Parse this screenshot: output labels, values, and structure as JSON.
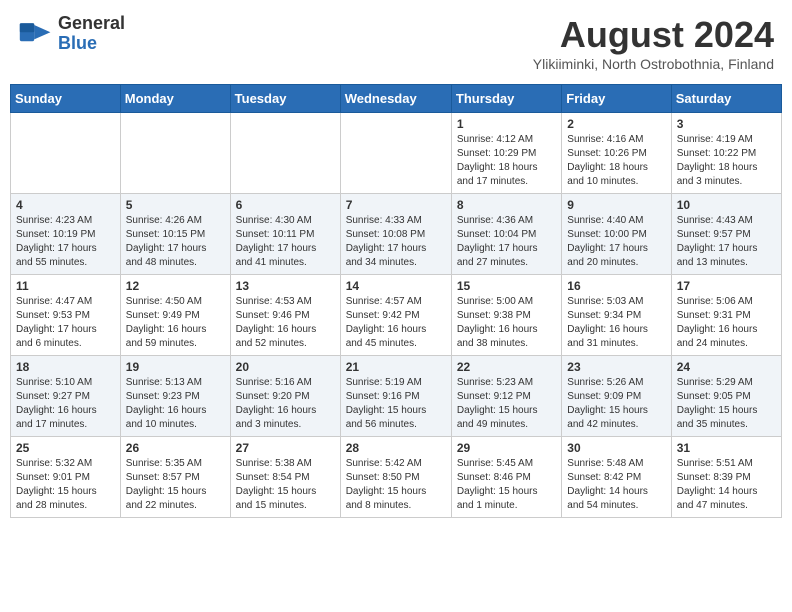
{
  "header": {
    "logo_general": "General",
    "logo_blue": "Blue",
    "month_title": "August 2024",
    "location": "Ylikiiminki, North Ostrobothnia, Finland"
  },
  "days_of_week": [
    "Sunday",
    "Monday",
    "Tuesday",
    "Wednesday",
    "Thursday",
    "Friday",
    "Saturday"
  ],
  "weeks": [
    [
      {
        "day": "",
        "info": ""
      },
      {
        "day": "",
        "info": ""
      },
      {
        "day": "",
        "info": ""
      },
      {
        "day": "",
        "info": ""
      },
      {
        "day": "1",
        "info": "Sunrise: 4:12 AM\nSunset: 10:29 PM\nDaylight: 18 hours\nand 17 minutes."
      },
      {
        "day": "2",
        "info": "Sunrise: 4:16 AM\nSunset: 10:26 PM\nDaylight: 18 hours\nand 10 minutes."
      },
      {
        "day": "3",
        "info": "Sunrise: 4:19 AM\nSunset: 10:22 PM\nDaylight: 18 hours\nand 3 minutes."
      }
    ],
    [
      {
        "day": "4",
        "info": "Sunrise: 4:23 AM\nSunset: 10:19 PM\nDaylight: 17 hours\nand 55 minutes."
      },
      {
        "day": "5",
        "info": "Sunrise: 4:26 AM\nSunset: 10:15 PM\nDaylight: 17 hours\nand 48 minutes."
      },
      {
        "day": "6",
        "info": "Sunrise: 4:30 AM\nSunset: 10:11 PM\nDaylight: 17 hours\nand 41 minutes."
      },
      {
        "day": "7",
        "info": "Sunrise: 4:33 AM\nSunset: 10:08 PM\nDaylight: 17 hours\nand 34 minutes."
      },
      {
        "day": "8",
        "info": "Sunrise: 4:36 AM\nSunset: 10:04 PM\nDaylight: 17 hours\nand 27 minutes."
      },
      {
        "day": "9",
        "info": "Sunrise: 4:40 AM\nSunset: 10:00 PM\nDaylight: 17 hours\nand 20 minutes."
      },
      {
        "day": "10",
        "info": "Sunrise: 4:43 AM\nSunset: 9:57 PM\nDaylight: 17 hours\nand 13 minutes."
      }
    ],
    [
      {
        "day": "11",
        "info": "Sunrise: 4:47 AM\nSunset: 9:53 PM\nDaylight: 17 hours\nand 6 minutes."
      },
      {
        "day": "12",
        "info": "Sunrise: 4:50 AM\nSunset: 9:49 PM\nDaylight: 16 hours\nand 59 minutes."
      },
      {
        "day": "13",
        "info": "Sunrise: 4:53 AM\nSunset: 9:46 PM\nDaylight: 16 hours\nand 52 minutes."
      },
      {
        "day": "14",
        "info": "Sunrise: 4:57 AM\nSunset: 9:42 PM\nDaylight: 16 hours\nand 45 minutes."
      },
      {
        "day": "15",
        "info": "Sunrise: 5:00 AM\nSunset: 9:38 PM\nDaylight: 16 hours\nand 38 minutes."
      },
      {
        "day": "16",
        "info": "Sunrise: 5:03 AM\nSunset: 9:34 PM\nDaylight: 16 hours\nand 31 minutes."
      },
      {
        "day": "17",
        "info": "Sunrise: 5:06 AM\nSunset: 9:31 PM\nDaylight: 16 hours\nand 24 minutes."
      }
    ],
    [
      {
        "day": "18",
        "info": "Sunrise: 5:10 AM\nSunset: 9:27 PM\nDaylight: 16 hours\nand 17 minutes."
      },
      {
        "day": "19",
        "info": "Sunrise: 5:13 AM\nSunset: 9:23 PM\nDaylight: 16 hours\nand 10 minutes."
      },
      {
        "day": "20",
        "info": "Sunrise: 5:16 AM\nSunset: 9:20 PM\nDaylight: 16 hours\nand 3 minutes."
      },
      {
        "day": "21",
        "info": "Sunrise: 5:19 AM\nSunset: 9:16 PM\nDaylight: 15 hours\nand 56 minutes."
      },
      {
        "day": "22",
        "info": "Sunrise: 5:23 AM\nSunset: 9:12 PM\nDaylight: 15 hours\nand 49 minutes."
      },
      {
        "day": "23",
        "info": "Sunrise: 5:26 AM\nSunset: 9:09 PM\nDaylight: 15 hours\nand 42 minutes."
      },
      {
        "day": "24",
        "info": "Sunrise: 5:29 AM\nSunset: 9:05 PM\nDaylight: 15 hours\nand 35 minutes."
      }
    ],
    [
      {
        "day": "25",
        "info": "Sunrise: 5:32 AM\nSunset: 9:01 PM\nDaylight: 15 hours\nand 28 minutes."
      },
      {
        "day": "26",
        "info": "Sunrise: 5:35 AM\nSunset: 8:57 PM\nDaylight: 15 hours\nand 22 minutes."
      },
      {
        "day": "27",
        "info": "Sunrise: 5:38 AM\nSunset: 8:54 PM\nDaylight: 15 hours\nand 15 minutes."
      },
      {
        "day": "28",
        "info": "Sunrise: 5:42 AM\nSunset: 8:50 PM\nDaylight: 15 hours\nand 8 minutes."
      },
      {
        "day": "29",
        "info": "Sunrise: 5:45 AM\nSunset: 8:46 PM\nDaylight: 15 hours\nand 1 minute."
      },
      {
        "day": "30",
        "info": "Sunrise: 5:48 AM\nSunset: 8:42 PM\nDaylight: 14 hours\nand 54 minutes."
      },
      {
        "day": "31",
        "info": "Sunrise: 5:51 AM\nSunset: 8:39 PM\nDaylight: 14 hours\nand 47 minutes."
      }
    ]
  ]
}
